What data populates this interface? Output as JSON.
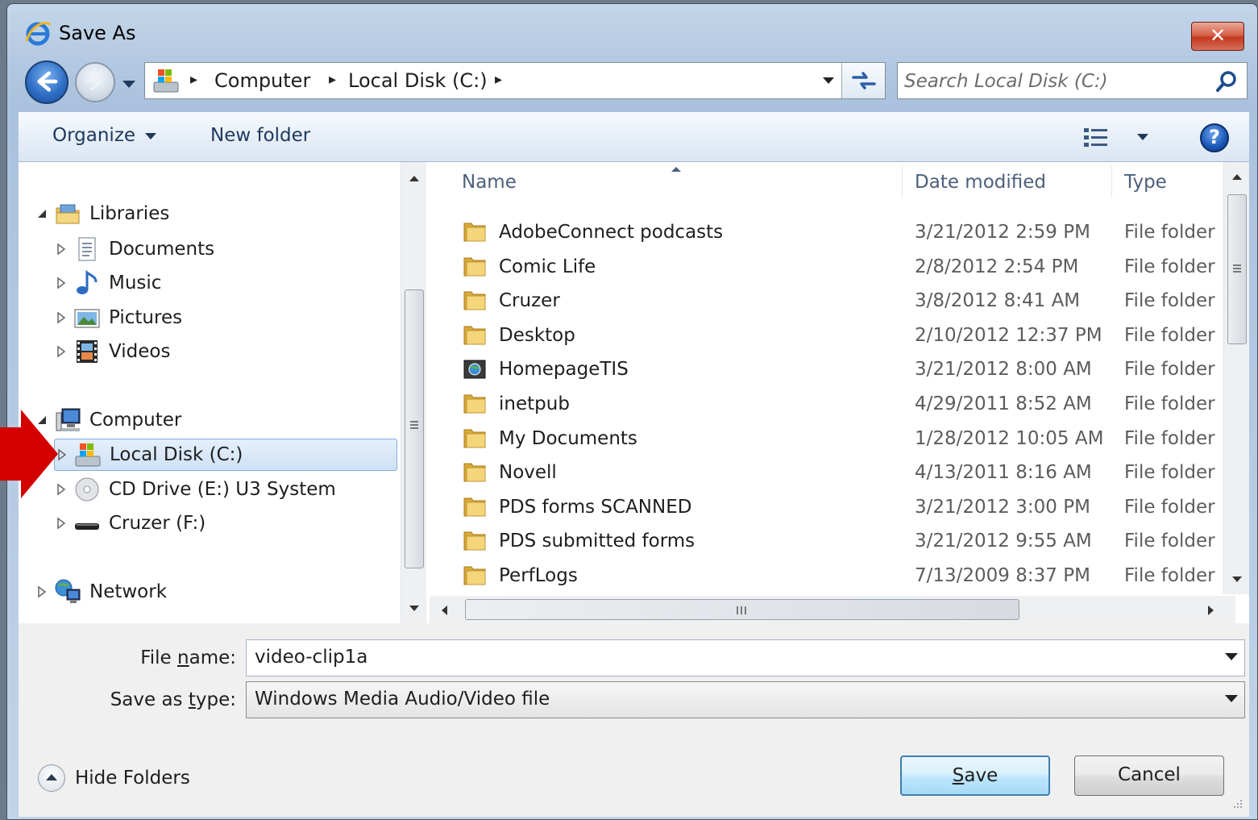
{
  "window": {
    "title": "Save As",
    "close_label": "✕"
  },
  "address_bar": {
    "crumbs": [
      "Computer",
      "Local Disk (C:)"
    ],
    "separator": "▸"
  },
  "search": {
    "placeholder": "Search Local Disk (C:)"
  },
  "toolbar": {
    "organize_label": "Organize",
    "new_folder_label": "New folder",
    "help_label": "?"
  },
  "nav_pane": {
    "libraries": "Libraries",
    "library_items": [
      "Documents",
      "Music",
      "Pictures",
      "Videos"
    ],
    "computer": "Computer",
    "computer_items": [
      "Local Disk (C:)",
      "CD Drive (E:) U3 System",
      "Cruzer (F:)"
    ],
    "network": "Network",
    "selected": "Local Disk (C:)"
  },
  "file_list": {
    "columns": [
      "Name",
      "Date modified",
      "Type"
    ],
    "rows": [
      {
        "name": "AdobeConnect podcasts",
        "date": "3/21/2012 2:59 PM",
        "type": "File folder",
        "icon": "folder-icon"
      },
      {
        "name": "Comic Life",
        "date": "2/8/2012 2:54 PM",
        "type": "File folder",
        "icon": "folder-icon"
      },
      {
        "name": "Cruzer",
        "date": "3/8/2012 8:41 AM",
        "type": "File folder",
        "icon": "folder-icon"
      },
      {
        "name": "Desktop",
        "date": "2/10/2012 12:37 PM",
        "type": "File folder",
        "icon": "folder-icon"
      },
      {
        "name": "HomepageTIS",
        "date": "3/21/2012 8:00 AM",
        "type": "File folder",
        "icon": "web-folder-icon"
      },
      {
        "name": "inetpub",
        "date": "4/29/2011 8:52 AM",
        "type": "File folder",
        "icon": "folder-icon"
      },
      {
        "name": "My Documents",
        "date": "1/28/2012 10:05 AM",
        "type": "File folder",
        "icon": "folder-icon"
      },
      {
        "name": "Novell",
        "date": "4/13/2011 8:16 AM",
        "type": "File folder",
        "icon": "folder-icon"
      },
      {
        "name": "PDS forms SCANNED",
        "date": "3/21/2012 3:00 PM",
        "type": "File folder",
        "icon": "folder-icon"
      },
      {
        "name": "PDS submitted forms",
        "date": "3/21/2012 9:55 AM",
        "type": "File folder",
        "icon": "folder-icon"
      },
      {
        "name": "PerfLogs",
        "date": "7/13/2009 8:37 PM",
        "type": "File folder",
        "icon": "folder-icon"
      }
    ]
  },
  "form": {
    "file_name_label_pre": "File ",
    "file_name_label_ul": "n",
    "file_name_label_post": "ame:",
    "file_name_value": "video-clip1a",
    "save_type_label_pre": "Save as ",
    "save_type_label_ul": "t",
    "save_type_label_post": "ype:",
    "save_type_value": "Windows Media Audio/Video file"
  },
  "footer": {
    "hide_folders_label": "Hide Folders",
    "save_ul": "S",
    "save_rest": "ave",
    "cancel_label": "Cancel"
  },
  "colors": {
    "annotation_arrow": "#d40000",
    "folder": "#e8c25a",
    "selection_border": "#84acdd"
  }
}
